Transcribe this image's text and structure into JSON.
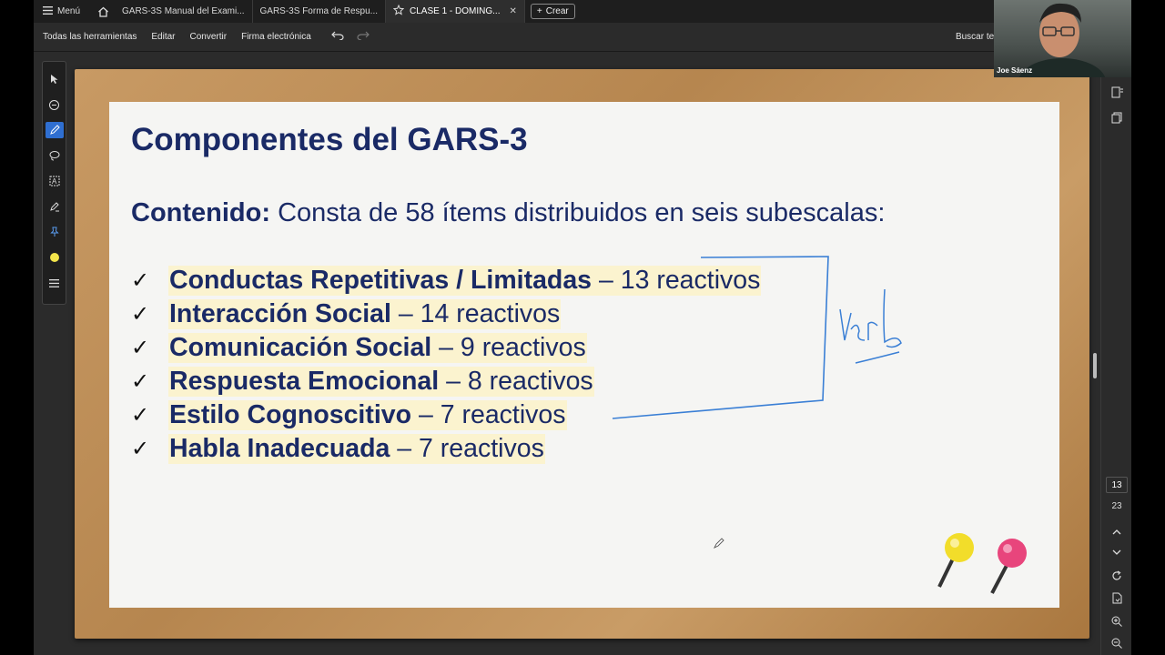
{
  "tabbar": {
    "menu_label": "Menú",
    "tabs": [
      {
        "label": "GARS-3S Manual del Exami..."
      },
      {
        "label": "GARS-3S Forma de Respu..."
      },
      {
        "label": "CLASE 1 -  DOMING..."
      }
    ],
    "create_label": "Crear"
  },
  "toolbar": {
    "items": [
      "Todas las herramientas",
      "Editar",
      "Convertir",
      "Firma electrónica"
    ],
    "search_label": "Buscar texto o herramientas"
  },
  "slide": {
    "title": "Componentes del GARS-3",
    "content_label": "Contenido:",
    "content_text": " Consta de 58 ítems distribuidos en seis subescalas:",
    "items": [
      {
        "name": "Conductas Repetitivas / Limitadas",
        "count": " – 13 reactivos"
      },
      {
        "name": "Interacción Social",
        "count": " – 14 reactivos"
      },
      {
        "name": "Comunicación Social",
        "count": " – 9 reactivos"
      },
      {
        "name": "Respuesta Emocional",
        "count": " – 8 reactivos"
      },
      {
        "name": "Estilo Cognoscitivo",
        "count": " – 7 reactivos"
      },
      {
        "name": "Habla Inadecuada",
        "count": " – 7 reactivos"
      }
    ],
    "check_mark": "✓",
    "annotation": "Verb"
  },
  "pagination": {
    "current": "13",
    "total": "23"
  },
  "webcam": {
    "name": "Joe Sáenz"
  },
  "colors": {
    "title": "#1a2a66",
    "highlight": "#fbf3cf",
    "ink": "#3a7fd5",
    "frame": "#c08f58"
  }
}
